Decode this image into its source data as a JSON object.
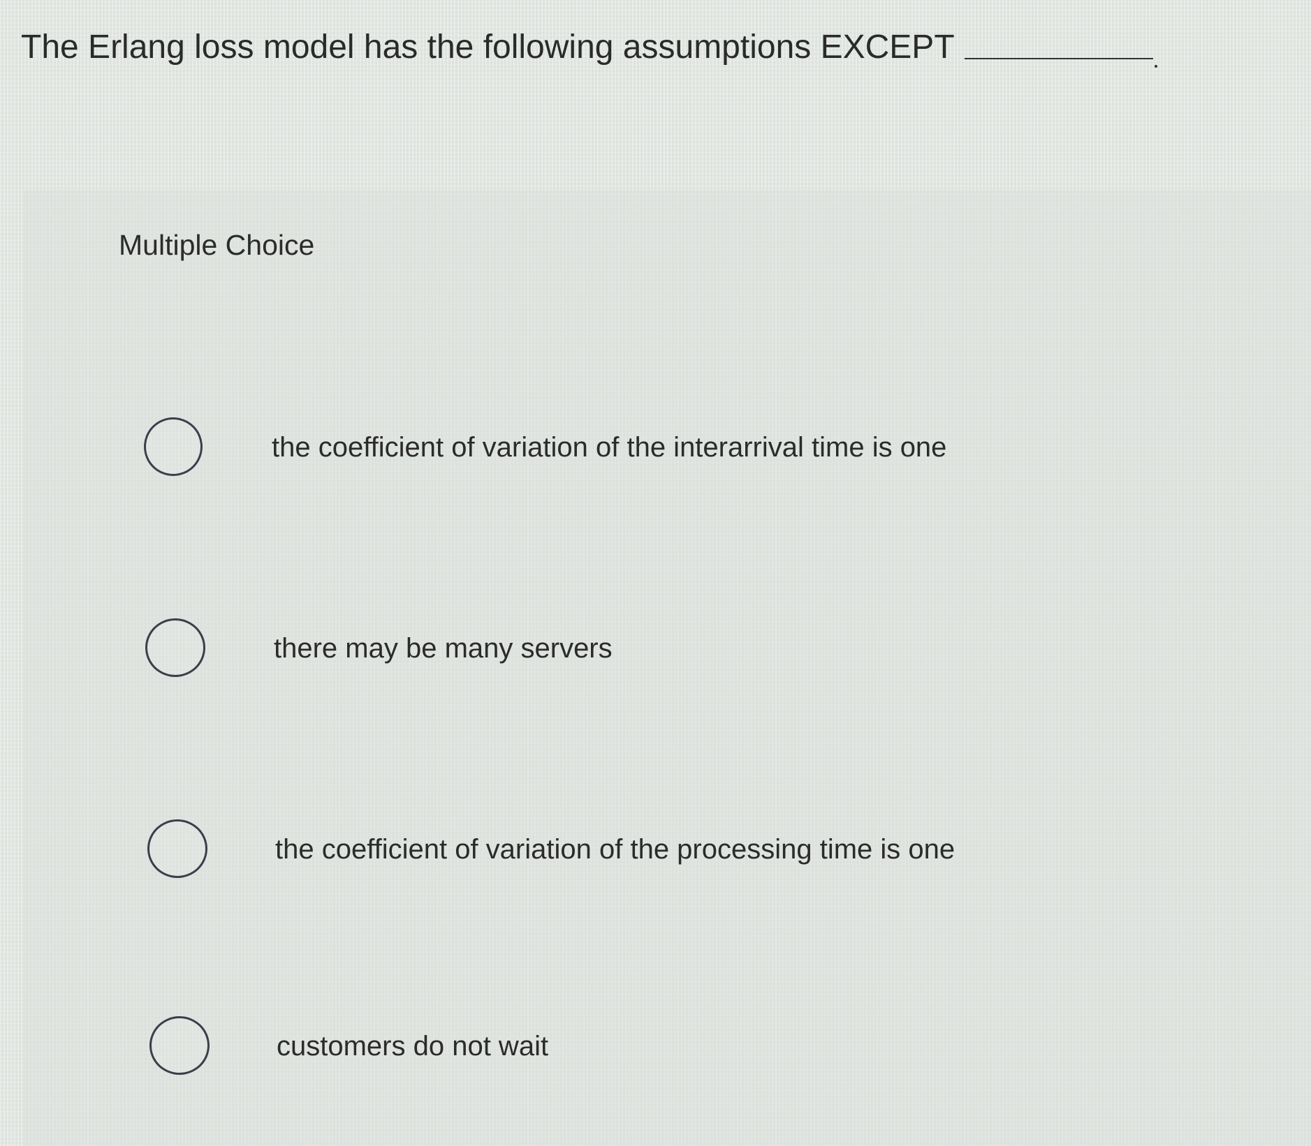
{
  "question": {
    "text": "The Erlang loss model has the following assumptions EXCEPT"
  },
  "multiple_choice": {
    "label": "Multiple Choice",
    "options": [
      {
        "label": "the coefficient of variation of the interarrival time is one",
        "selected": false
      },
      {
        "label": "there may be many servers",
        "selected": false
      },
      {
        "label": "the coefficient of variation of the processing time is one",
        "selected": false
      },
      {
        "label": "customers do not wait",
        "selected": false
      }
    ]
  }
}
